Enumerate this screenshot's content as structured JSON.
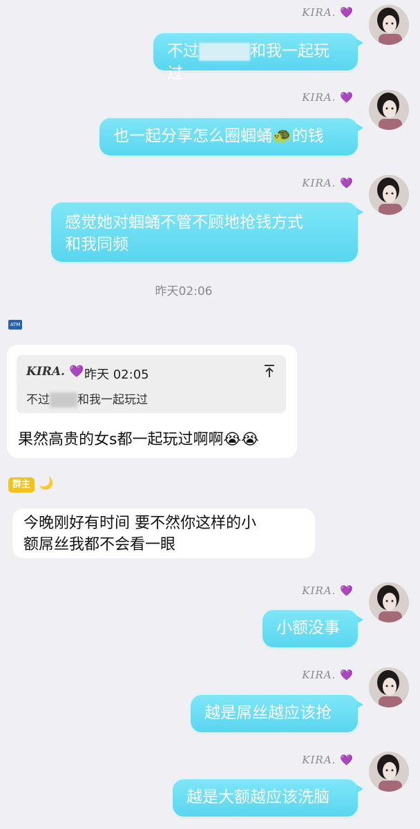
{
  "sender": {
    "nickname": "KIRA.",
    "heart": "💜"
  },
  "messages": [
    {
      "text_before": "不过",
      "text_after": "和我一起玩过"
    },
    {
      "text_before": "也一起分享怎么圈蝈蛹",
      "emoji": "🐢",
      "text_after": "的钱"
    },
    {
      "line1": "感觉她对蝈蛹不管不顾地抢钱方式",
      "line2": "和我同频"
    }
  ],
  "timestamp": "昨天02:06",
  "left_user_badge": "ATM",
  "reply_message": {
    "quoted_nick": "KIRA.",
    "quoted_heart": "💜",
    "quoted_time": "昨天 02:05",
    "quoted_before": "不过",
    "quoted_after": "和我一起玩过",
    "text": "果然高贵的女s都一起玩过啊啊",
    "emoji": "😭😭"
  },
  "owner_badge": "群主",
  "owner_moon": "🌙",
  "owner_message": {
    "line1": "今晚刚好有时间 要不然你这样的小",
    "line2": "额屌丝我都不会看一眼"
  },
  "messages_after": [
    "小额没事",
    "越是屌丝越应该抢",
    "越是大额越应该洗脑"
  ]
}
